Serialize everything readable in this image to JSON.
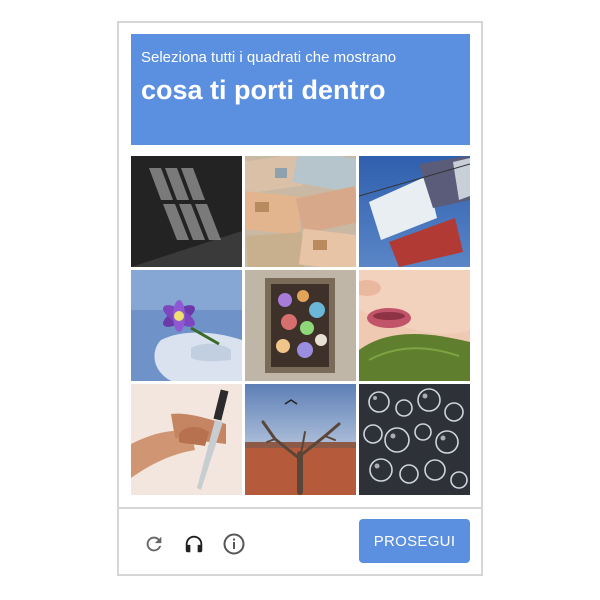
{
  "captcha": {
    "instruction": "Seleziona tutti i quadrati che mostrano",
    "target": "cosa ti porti dentro",
    "submit_label": "PROSEGUI"
  },
  "tiles": [
    {
      "index": 1,
      "content": "window-shadow"
    },
    {
      "index": 2,
      "content": "euro-banknotes"
    },
    {
      "index": 3,
      "content": "prayer-flags"
    },
    {
      "index": 4,
      "content": "purple-flower-in-hand"
    },
    {
      "index": 5,
      "content": "opals-in-box"
    },
    {
      "index": 6,
      "content": "face-with-leaf"
    },
    {
      "index": 7,
      "content": "hand-holding-knife"
    },
    {
      "index": 8,
      "content": "dead-tree-desert"
    },
    {
      "index": 9,
      "content": "soap-bubbles"
    }
  ],
  "icons": [
    "reload-icon",
    "headphones-icon",
    "info-icon"
  ],
  "colors": {
    "accent": "#5b8fe0",
    "border": "#d6d6d6"
  }
}
